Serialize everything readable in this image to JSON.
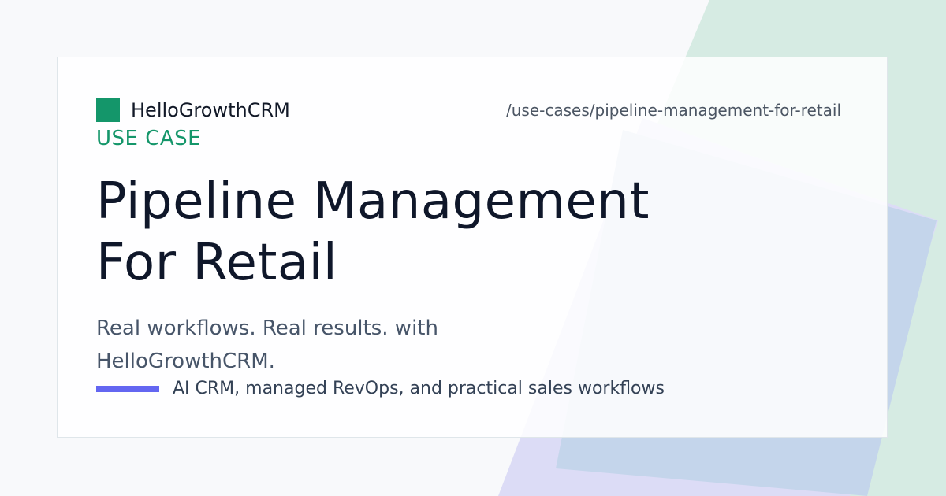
{
  "brand": {
    "name": "HelloGrowthCRM",
    "logo_color": "#14966a"
  },
  "path": "/use-cases/pipeline-management-for-retail",
  "eyebrow": "USE CASE",
  "title": {
    "line1": "Pipeline Management",
    "line2": "For Retail"
  },
  "subtitle": {
    "line1": "Real workflows. Real results. with",
    "line2": "HelloGrowthCRM."
  },
  "tagline": "AI CRM, managed RevOps, and practical sales workflows",
  "colors": {
    "accent": "#6366f1",
    "brand_green": "#14966a",
    "title": "#0f172a",
    "background_green": "#d6ebe3",
    "background_blue": "#c4d5eb",
    "background_lavender": "#dcdcf6"
  }
}
